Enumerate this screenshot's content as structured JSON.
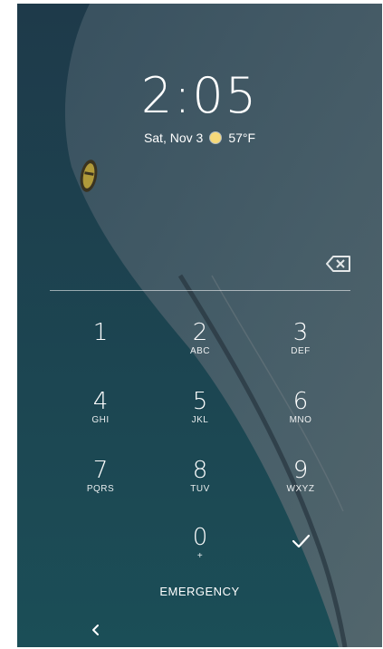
{
  "lockscreen": {
    "time": "2:05",
    "date": "Sat, Nov 3",
    "weather_icon": "sun-icon",
    "temperature": "57°F",
    "emergency_label": "EMERGENCY",
    "accent_colors": {
      "wallpaper_dark": "#1c3446",
      "sand": "#5a6b72",
      "text": "#ffffff"
    }
  },
  "keypad": {
    "keys": [
      {
        "digit": "1",
        "letters": ""
      },
      {
        "digit": "2",
        "letters": "ABC"
      },
      {
        "digit": "3",
        "letters": "DEF"
      },
      {
        "digit": "4",
        "letters": "GHI"
      },
      {
        "digit": "5",
        "letters": "JKL"
      },
      {
        "digit": "6",
        "letters": "MNO"
      },
      {
        "digit": "7",
        "letters": "PQRS"
      },
      {
        "digit": "8",
        "letters": "TUV"
      },
      {
        "digit": "9",
        "letters": "WXYZ"
      },
      {
        "digit": "0",
        "letters": "+"
      }
    ]
  },
  "icons": {
    "backspace": "backspace-icon",
    "enter": "check-icon",
    "nav_back": "chevron-left-icon"
  }
}
